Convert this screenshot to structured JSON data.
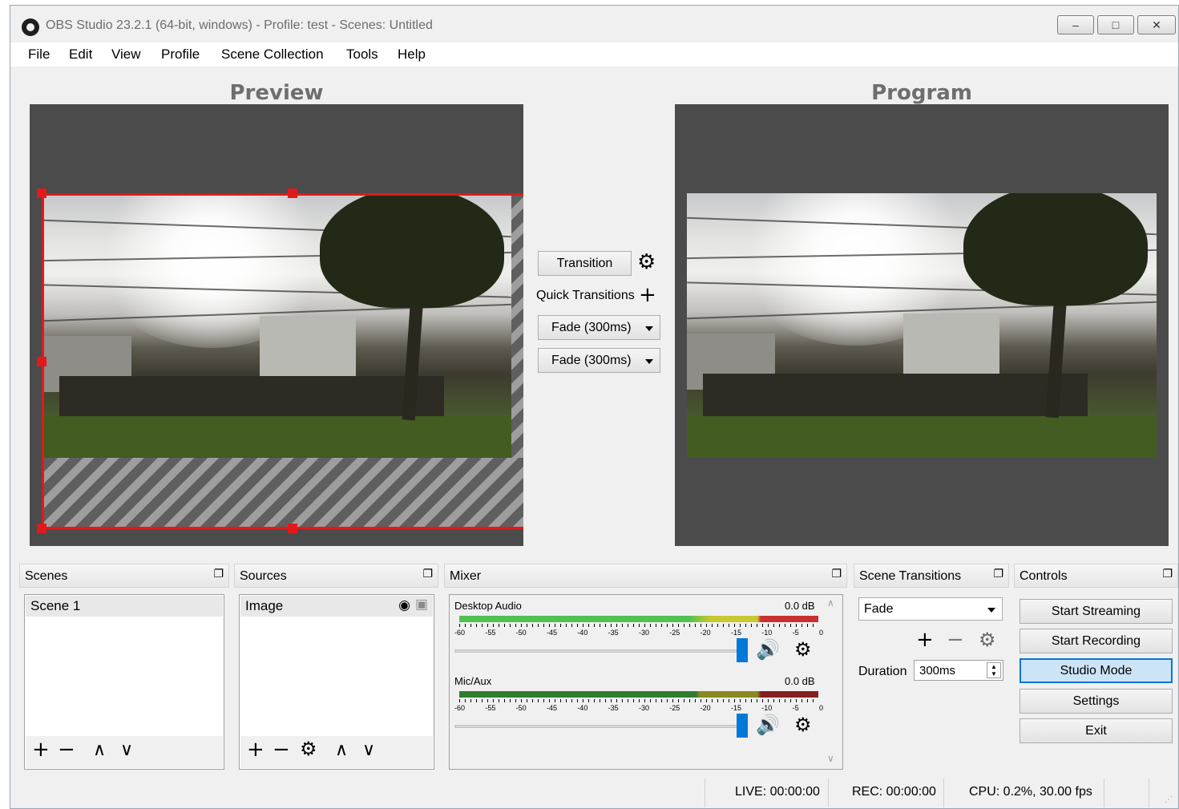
{
  "window": {
    "title": "OBS Studio 23.2.1 (64-bit, windows) - Profile: test - Scenes: Untitled",
    "controls": [
      "minimize-icon",
      "restore-icon",
      "close-icon"
    ]
  },
  "menu": [
    "File",
    "Edit",
    "View",
    "Profile",
    "Scene Collection",
    "Tools",
    "Help"
  ],
  "preview": {
    "title": "Preview"
  },
  "program": {
    "title": "Program"
  },
  "studio": {
    "transition_label": "Transition",
    "quick_transitions_label": "Quick Transitions",
    "quick_1": "Fade (300ms)",
    "quick_2": "Fade (300ms)"
  },
  "scenes": {
    "title": "Scenes",
    "items": [
      "Scene 1"
    ]
  },
  "sources": {
    "title": "Sources",
    "items": [
      "Image"
    ]
  },
  "mixer": {
    "title": "Mixer",
    "channels": [
      {
        "name": "Desktop Audio",
        "db": "0.0 dB",
        "level": 1.0
      },
      {
        "name": "Mic/Aux",
        "db": "0.0 dB",
        "level": 1.0
      }
    ],
    "ticks": [
      "-60",
      "-55",
      "-50",
      "-45",
      "-40",
      "-35",
      "-30",
      "-25",
      "-20",
      "-15",
      "-10",
      "-5",
      "0"
    ]
  },
  "transitions": {
    "title": "Scene Transitions",
    "selected": "Fade",
    "duration_label": "Duration",
    "duration_value": "300ms"
  },
  "controls": {
    "title": "Controls",
    "buttons": [
      "Start Streaming",
      "Start Recording",
      "Studio Mode",
      "Settings",
      "Exit"
    ]
  },
  "status": {
    "live": "LIVE: 00:00:00",
    "rec": "REC: 00:00:00",
    "cpu": "CPU: 0.2%, 30.00 fps"
  },
  "colors": {
    "accent": "#0078d7",
    "selection": "#e01a1a",
    "canvas_bg": "#4b4b4b"
  }
}
